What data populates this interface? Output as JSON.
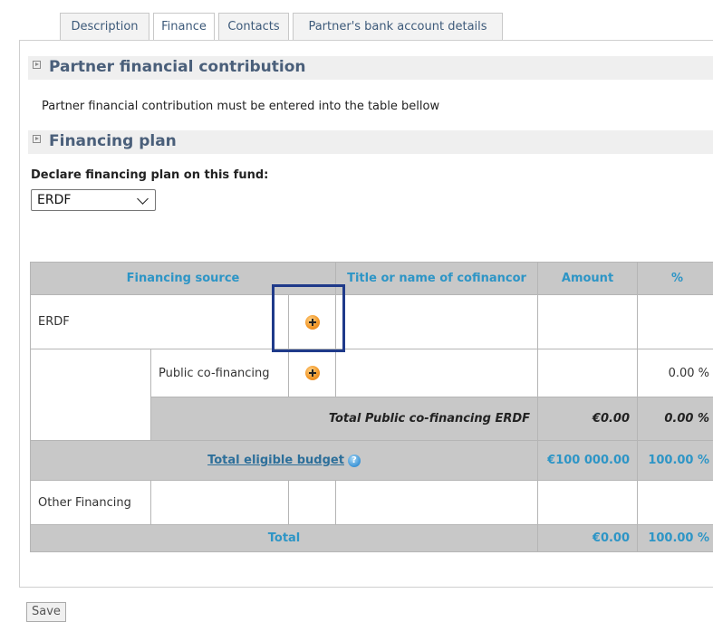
{
  "tabs": [
    {
      "label": "Description"
    },
    {
      "label": "Finance"
    },
    {
      "label": "Contacts"
    },
    {
      "label": "Partner's bank account details"
    }
  ],
  "sections": {
    "contribution_title": "Partner financial contribution",
    "contribution_text": "Partner financial contribution must be entered into the table bellow",
    "plan_title": "Financing plan",
    "declare_label": "Declare financing plan on this fund:",
    "fund_select_value": "ERDF"
  },
  "table": {
    "headers": {
      "source": "Financing source",
      "title": "Title or name of cofinancor",
      "amount": "Amount",
      "percent": "%"
    },
    "erdf_label": "ERDF",
    "public_label": "Public co-financing",
    "public_percent": "0.00 %",
    "total_public_label": "Total Public co-financing ERDF",
    "total_public_amount": "€0.00",
    "total_public_percent": "0.00 %",
    "eligible_label": "Total eligible budget",
    "eligible_amount": "€100 000.00",
    "eligible_percent": "100.00 %",
    "other_label": "Other Financing",
    "total_label": "Total",
    "total_amount": "€0.00",
    "total_percent": "100.00 %"
  },
  "icons": {
    "add": "add-icon",
    "help": "help-icon",
    "help_glyph": "?"
  },
  "footer": {
    "save_label": "Save"
  },
  "colors": {
    "header_text": "#2d95c6",
    "highlight": "#1f3a8a",
    "section_title": "#4a5f7a"
  }
}
